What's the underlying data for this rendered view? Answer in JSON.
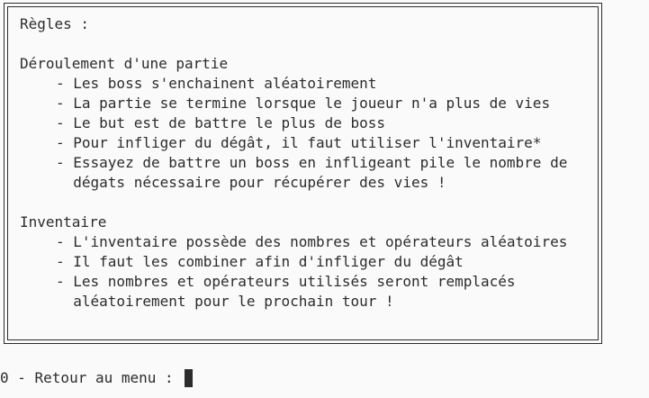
{
  "rules": {
    "title": "Règles :",
    "sections": [
      {
        "heading": "Déroulement d'une partie",
        "items": [
          "Les boss s'enchainent aléatoirement",
          "La partie se termine lorsque le joueur n'a plus de vies",
          "Le but est de battre le plus de boss",
          "Pour infliger du dégât, il faut utiliser l'inventaire*",
          "Essayez de battre un boss en infligeant pile le nombre de\ndégats nécessaire pour récupérer des vies !"
        ]
      },
      {
        "heading": "Inventaire",
        "items": [
          "L'inventaire possède des nombres et opérateurs aléatoires",
          "Il faut les combiner afin d'infliger du dégât",
          "Les nombres et opérateurs utilisés seront remplacés\naléatoirement pour le prochain tour !"
        ]
      }
    ],
    "bullet": "- "
  },
  "prompt": {
    "label": "0 - Retour au menu : "
  }
}
